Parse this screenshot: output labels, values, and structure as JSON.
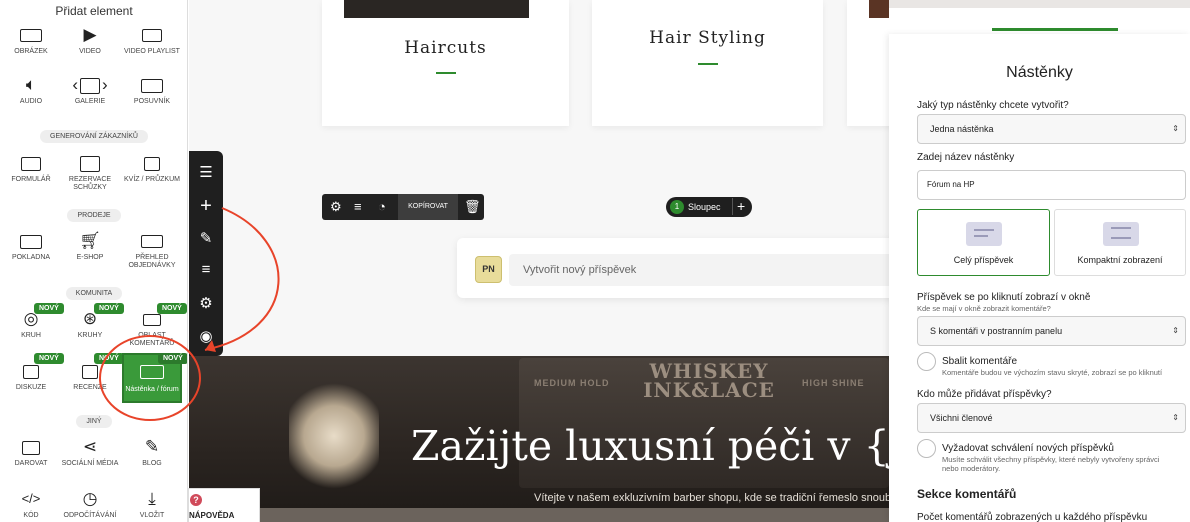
{
  "left_panel": {
    "title": "Přidat element",
    "items": [
      {
        "label": "Obrázek",
        "icon": "image-icon"
      },
      {
        "label": "Video",
        "icon": "video-icon"
      },
      {
        "label": "Video playlist",
        "icon": "video-playlist-icon"
      },
      {
        "label": "Audio",
        "icon": "speaker-icon"
      },
      {
        "label": "Galerie",
        "icon": "gallery-icon"
      },
      {
        "label": "Posuvník",
        "icon": "slider-icon"
      },
      {
        "label": "Formulář",
        "icon": "form-icon"
      },
      {
        "label": "Rezervace schůzky",
        "icon": "calendar-icon"
      },
      {
        "label": "Kvíz / průzkum",
        "icon": "quiz-icon"
      },
      {
        "label": "Pokladna",
        "icon": "checkout-icon"
      },
      {
        "label": "E-shop",
        "icon": "cart-icon"
      },
      {
        "label": "Přehled objednávky",
        "icon": "order-summary-icon"
      },
      {
        "label": "Kruh",
        "icon": "circle-icon"
      },
      {
        "label": "Kruhy",
        "icon": "circles-icon"
      },
      {
        "label": "Oblast komentářů",
        "icon": "comments-icon"
      },
      {
        "label": "Diskuze",
        "icon": "discussion-icon"
      },
      {
        "label": "Recenze",
        "icon": "review-icon"
      },
      {
        "label": "Nástěnka / fórum",
        "icon": "forum-icon"
      },
      {
        "label": "Darovat",
        "icon": "donate-icon"
      },
      {
        "label": "Sociální média",
        "icon": "share-icon"
      },
      {
        "label": "Blog",
        "icon": "pencil-icon"
      },
      {
        "label": "Kód",
        "icon": "code-icon"
      },
      {
        "label": "Odpočítávání",
        "icon": "countdown-icon"
      },
      {
        "label": "Vložit",
        "icon": "embed-icon"
      }
    ],
    "sections": [
      "Generování zákazníků",
      "Prodeje",
      "Komunita",
      "Jiný"
    ],
    "badge": "NOVÝ",
    "help": "NÁPOVĚDA"
  },
  "canvas": {
    "cards": [
      "Haircuts",
      "Hair Styling"
    ],
    "toolbar_copy": "KOPÍROVAT",
    "column_pill": {
      "number": "1",
      "label": "Sloupec"
    },
    "post_box": {
      "avatar": "PN",
      "placeholder": "Vytvořit nový příspěvek"
    },
    "hero": {
      "brand_line1": "WHISKEY",
      "brand_line2": "INK&LACE",
      "left_tag": "MEDIUM HOLD",
      "right_tag": "HIGH SHINE",
      "heading": "Zažijte luxusní péči v {jr",
      "subtext": "Vítejte v našem exkluzivním barber shopu, kde se tradiční řemeslo snoubí"
    }
  },
  "settings": {
    "title": "Nástěnky",
    "q_type": "Jaký typ nástěnky chcete vytvořit?",
    "type_value": "Jedna nástěnka",
    "q_name": "Zadej název nástěnky",
    "name_value": "Fórum na HP",
    "layout_options": [
      "Celý příspěvek",
      "Kompaktní zobrazení"
    ],
    "q_window": "Příspěvek se po kliknutí zobrazí v okně",
    "window_hint": "Kde se mají v okně zobrazit komentáře?",
    "window_value": "S komentáři v postranním panelu",
    "collapse_label": "Sbalit komentáře",
    "collapse_hint": "Komentáře budou ve výchozím stavu skryté, zobrazí se po kliknutí",
    "q_who": "Kdo může přidávat příspěvky?",
    "who_value": "Všichni členové",
    "approve_label": "Vyžadovat schválení nových příspěvků",
    "approve_hint": "Musíte schválit všechny příspěvky, které nebyly vytvořeny správci nebo moderátory.",
    "comments_section": "Sekce komentářů",
    "comments_count_label": "Počet komentářů zobrazených u každého příspěvku"
  },
  "colors": {
    "accent": "#2e8b2e",
    "annotation": "#e8442a",
    "toolbar": "#1f1f1f"
  }
}
